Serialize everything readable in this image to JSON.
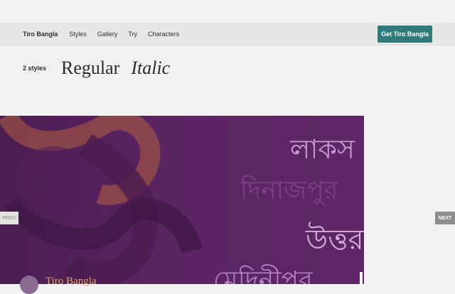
{
  "nav": {
    "brand": "Tiro Bangla",
    "links": [
      "Styles",
      "Gallery",
      "Try",
      "Characters"
    ],
    "cta": "Get Tiro Bangla"
  },
  "styles": {
    "count_label": "2 styles",
    "names": [
      "Regular",
      "Italic"
    ]
  },
  "carousel": {
    "prev_label": "PREV",
    "next_label": "NEXT",
    "words": [
      "লাকস",
      "দিনাজপুর",
      "উত্তর",
      "মেদিনীপুর"
    ],
    "caption": "Tiro Bangla"
  },
  "colors": {
    "accent_button": "#2f7a7b",
    "hero_background": "#5b2463",
    "hero_swirl": "#b3603e",
    "caption_text": "#e7a760"
  }
}
